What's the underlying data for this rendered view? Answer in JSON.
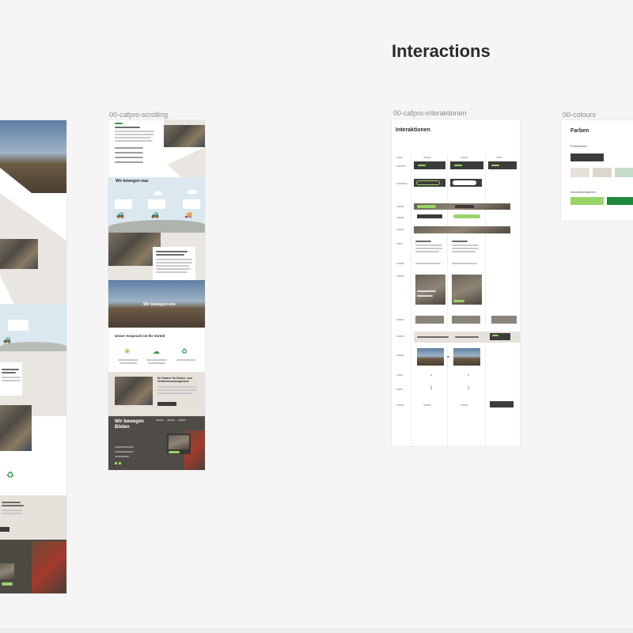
{
  "section_title": "Interactions",
  "frames": {
    "scrolling": {
      "label": "00-cafpro-scrolling"
    },
    "interaktionen": {
      "label": "00-cafpro-interaktionen",
      "title": "Interaktionen"
    },
    "colours": {
      "label": "00-colours",
      "title": "Farben",
      "sub1": "Primärfarbe",
      "sub2": "Interaktionsfarben"
    }
  },
  "site": {
    "hero_band": "Wir bewegen was",
    "mid_heading": "Wir bewegen uns",
    "promise_heading": "Unser Anspruch ist Ihr Vorteil",
    "partner_heading": "Ihr Partner für Boden- und Verfahrensmanagement",
    "bottom_heading": "Wir bewegen Böden"
  },
  "colors": {
    "dark": "#3c3c3b",
    "green_light": "#9ad36a",
    "green_dark": "#1f8a3a",
    "beige": "#e6e1da",
    "sky": "#dbe8f0"
  }
}
